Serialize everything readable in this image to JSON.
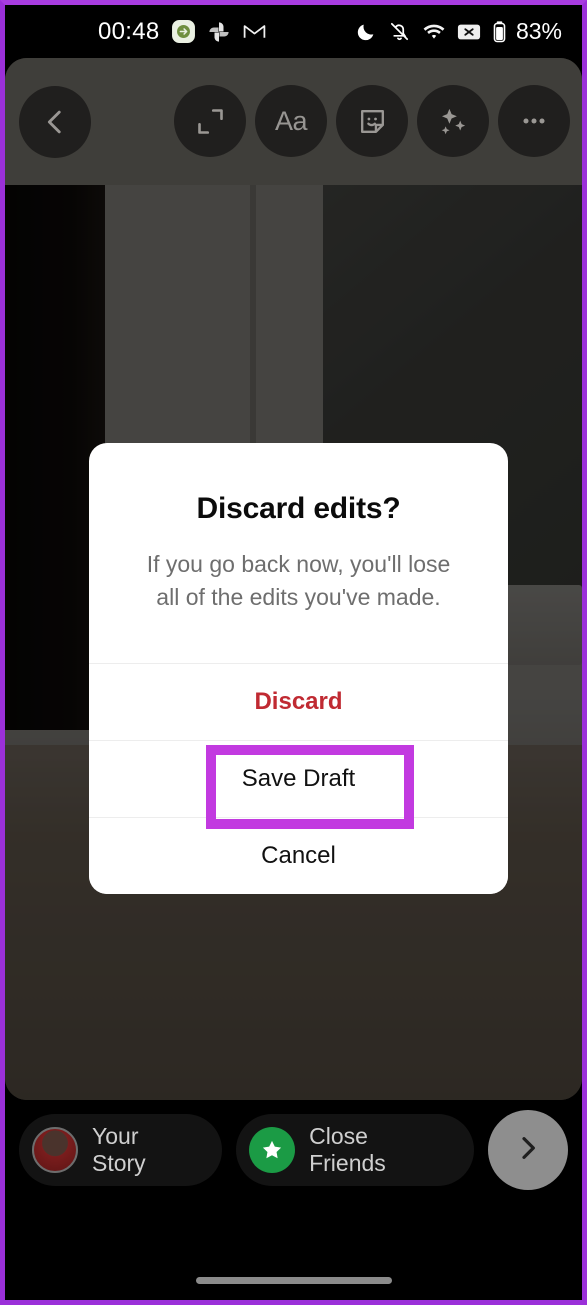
{
  "status_bar": {
    "clock": "00:48",
    "battery_percent": "83%",
    "left_icons": [
      "message-icon",
      "google-photos-icon",
      "gmail-icon"
    ],
    "right_icons": [
      "do-not-disturb-moon-icon",
      "notifications-muted-icon",
      "wifi-icon",
      "no-sim-icon",
      "battery-icon"
    ]
  },
  "editor_toolbar": {
    "back_icon": "chevron-left-icon",
    "tools": [
      {
        "name": "crop-icon",
        "label": ""
      },
      {
        "name": "text-tool-icon",
        "label": "Aa"
      },
      {
        "name": "sticker-icon",
        "label": ""
      },
      {
        "name": "effects-sparkle-icon",
        "label": ""
      },
      {
        "name": "more-options-icon",
        "label": ""
      }
    ]
  },
  "dialog": {
    "title": "Discard edits?",
    "message": "If you go back now, you'll lose all of the edits you've made.",
    "buttons": [
      {
        "id": "discard",
        "label": "Discard",
        "color": "#c02a32",
        "emphasis": "destructive"
      },
      {
        "id": "save-draft",
        "label": "Save Draft",
        "color": "#111111",
        "emphasis": "normal"
      },
      {
        "id": "cancel",
        "label": "Cancel",
        "color": "#111111",
        "emphasis": "normal"
      }
    ]
  },
  "annotation": {
    "highlighted_target": "Save Draft",
    "box_color": "#c23ae0"
  },
  "share_bar": {
    "your_story_label": "Your Story",
    "close_friends_label": "Close Friends",
    "next_icon": "chevron-right-icon"
  },
  "colors": {
    "accent_highlight": "#c23ae0",
    "destructive": "#c02a32",
    "close_friends_green": "#1b9b45",
    "dialog_background": "#ffffff",
    "toolbar_background": "#5b5953"
  }
}
